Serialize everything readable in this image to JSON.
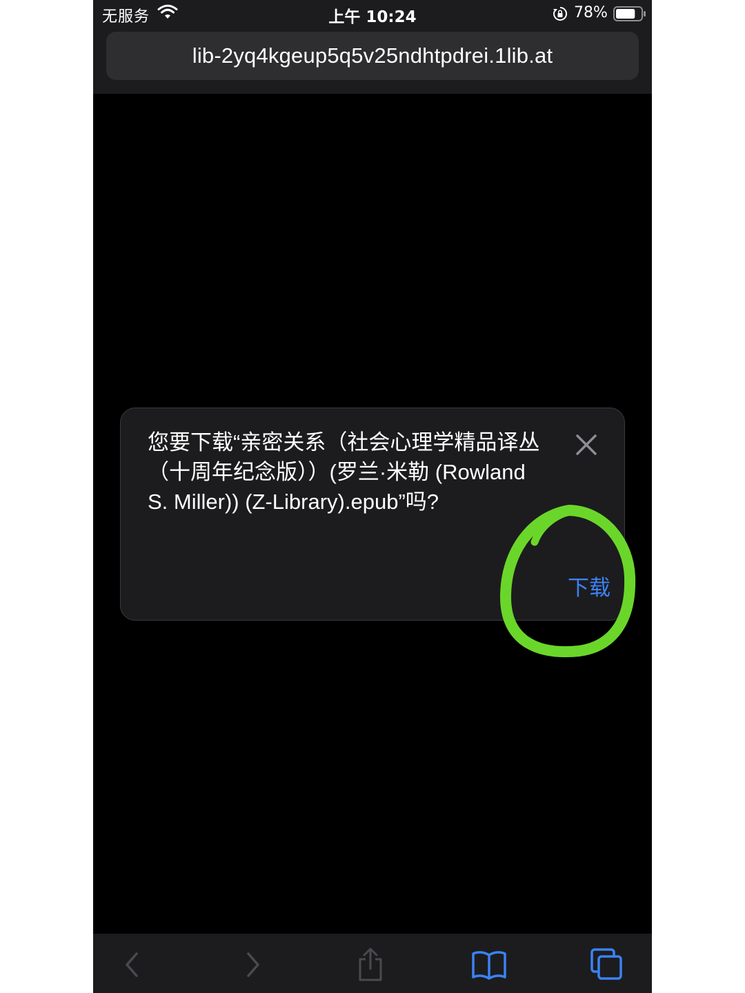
{
  "status_bar": {
    "carrier": "无服务",
    "time": "上午 10:24",
    "battery_percent": "78%",
    "battery_level": 0.78
  },
  "browser": {
    "url": "lib-2yq4kgeup5q5v25ndhtpdrei.1lib.at"
  },
  "dialog": {
    "message": "您要下载“亲密关系（社会心理学精品译丛（十周年纪念版））(罗兰·米勒 (Rowland S. Miller)) (Z-Library).epub”吗?",
    "download_label": "下载"
  },
  "toolbar": {
    "icons": [
      "back-icon",
      "forward-icon",
      "share-icon",
      "bookmarks-icon",
      "tabs-icon"
    ]
  },
  "colors": {
    "accent_blue": "#3b82f6",
    "highlight_green": "#6bd62a",
    "disabled_gray": "#4a4a4e"
  }
}
